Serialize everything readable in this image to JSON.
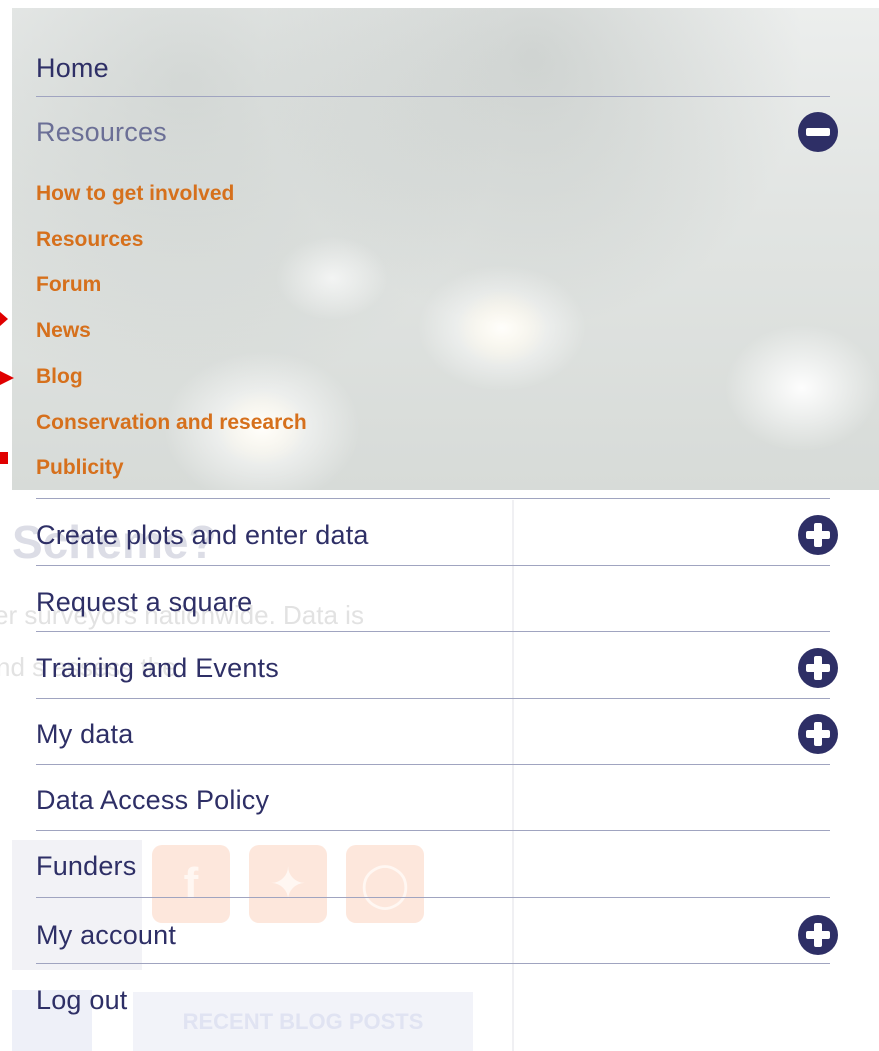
{
  "menu": {
    "items": [
      {
        "label": "Home",
        "toggle": null
      },
      {
        "label": "Resources",
        "toggle": "minus",
        "expanded": true
      },
      {
        "label": "Create plots and enter data",
        "toggle": "plus"
      },
      {
        "label": "Request a square",
        "toggle": null
      },
      {
        "label": "Training and Events",
        "toggle": "plus"
      },
      {
        "label": "My data",
        "toggle": "plus"
      },
      {
        "label": "Data Access Policy",
        "toggle": null
      },
      {
        "label": "Funders",
        "toggle": null
      },
      {
        "label": "My account",
        "toggle": "plus"
      },
      {
        "label": "Log out",
        "toggle": null
      }
    ],
    "resources_submenu": [
      "How to get involved",
      "Resources",
      "Forum",
      "News",
      "Blog",
      "Conservation and research",
      "Publicity"
    ]
  },
  "background_page": {
    "heading_fragment": "Scheme?",
    "text_line_1": "er surveyors nationwide. Data is",
    "text_line_2": "nd                                   s assess the",
    "social_icons": [
      "facebook-icon",
      "twitter-icon",
      "instagram-icon"
    ],
    "recent_blog_posts_label": "RECENT BLOG POSTS"
  },
  "colors": {
    "menu_text": "#2e2f66",
    "active_muted": "#6b6f96",
    "submenu_text": "#d6701c",
    "divider": "#a0a4c0",
    "toggle_bg": "#2e2f66",
    "annotation_arrow": "#e00000"
  }
}
